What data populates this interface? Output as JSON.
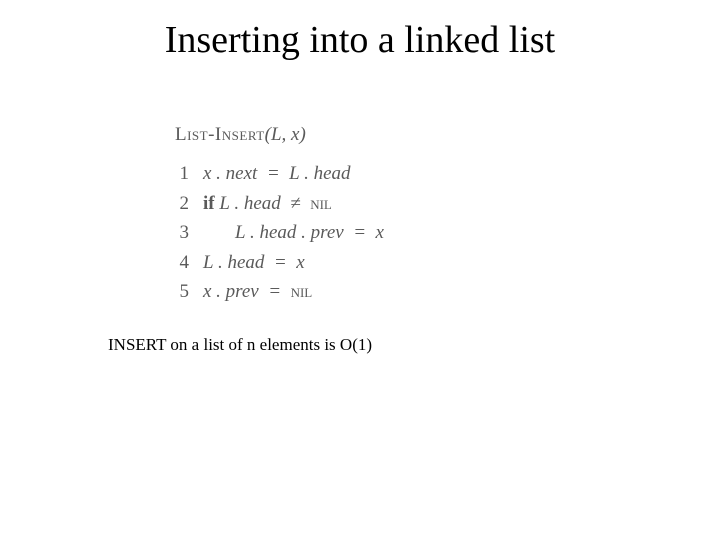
{
  "title": "Inserting into a linked list",
  "algo": {
    "name": "List-Insert",
    "args": "(L, x)",
    "lines": [
      {
        "n": "1",
        "indent": 0,
        "kw": "",
        "body_it": "x . next  =  L . head",
        "tail_sc": ""
      },
      {
        "n": "2",
        "indent": 0,
        "kw": "if",
        "body_it": " L . head  ≠  ",
        "tail_sc": "nil"
      },
      {
        "n": "3",
        "indent": 1,
        "kw": "",
        "body_it": "L . head . prev  =  x",
        "tail_sc": ""
      },
      {
        "n": "4",
        "indent": 0,
        "kw": "",
        "body_it": "L . head  =  x",
        "tail_sc": ""
      },
      {
        "n": "5",
        "indent": 0,
        "kw": "",
        "body_it": "x . prev  =  ",
        "tail_sc": "nil"
      }
    ]
  },
  "footnote": "INSERT on a list of n elements is O(1)"
}
